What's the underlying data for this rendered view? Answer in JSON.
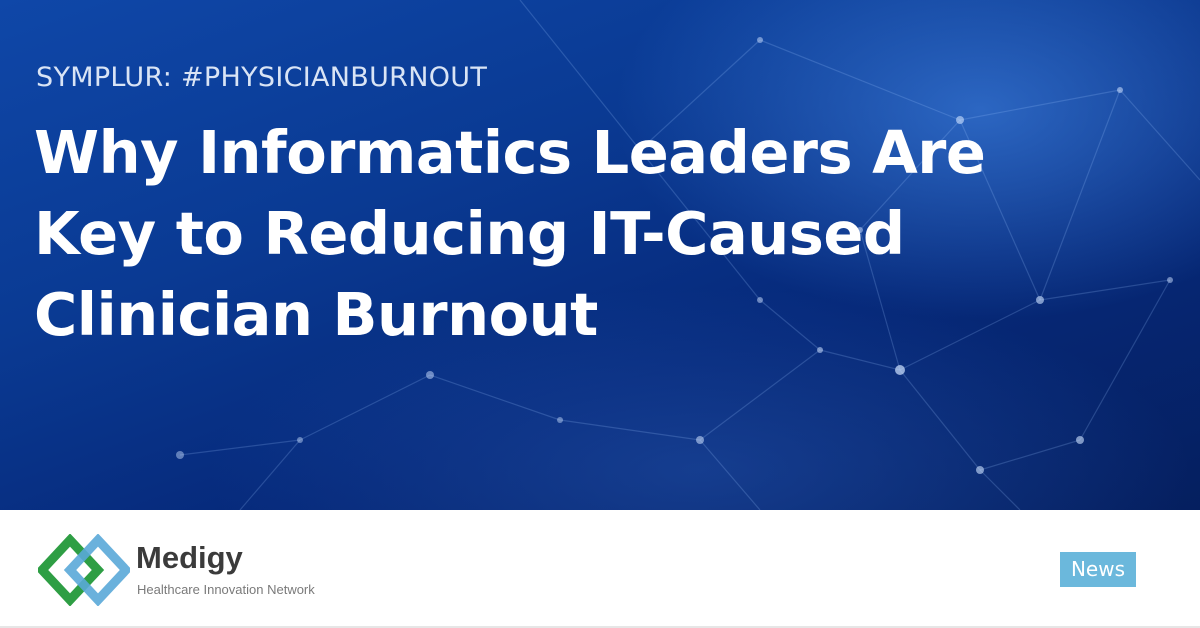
{
  "hero": {
    "tagline": "SYMPLUR: #PHYSICIANBURNOUT",
    "headline_lines": [
      "Why Informatics Leaders Are",
      "Key to Reducing IT-Caused",
      "Clinician Burnout"
    ],
    "background_icon": "network-nodes-icon"
  },
  "brand": {
    "name": "Medigy",
    "subtitle": "Healthcare Innovation Network",
    "logo_icon": "medigy-logo-icon",
    "colors": {
      "green": "#2e9e44",
      "blue": "#5aa9d8",
      "text": "#3b3b3b"
    }
  },
  "badge": {
    "label": "News",
    "color": "#6bb8dc"
  }
}
